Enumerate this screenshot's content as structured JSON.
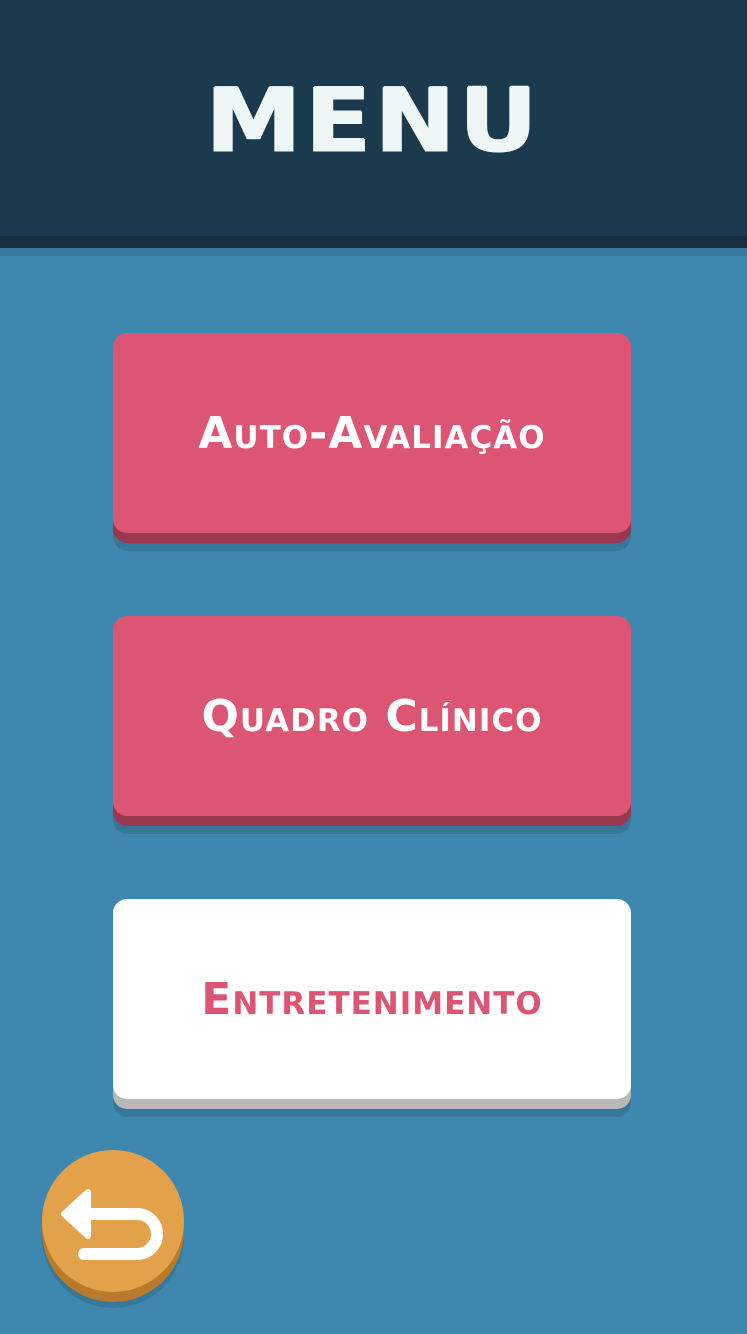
{
  "header": {
    "title": "MENU"
  },
  "menu": {
    "items": [
      {
        "label": "Auto-Avaliação",
        "style": "pink"
      },
      {
        "label": "Quadro Clínico",
        "style": "pink"
      },
      {
        "label": "Entretenimento",
        "style": "white"
      }
    ]
  },
  "back_button": {
    "icon": "back-arrow-icon"
  },
  "colors": {
    "background": "#3e88b0",
    "header": "#1b3a4d",
    "primary_button": "#dc5572",
    "secondary_button": "#ffffff",
    "back_button": "#e3a24a"
  }
}
